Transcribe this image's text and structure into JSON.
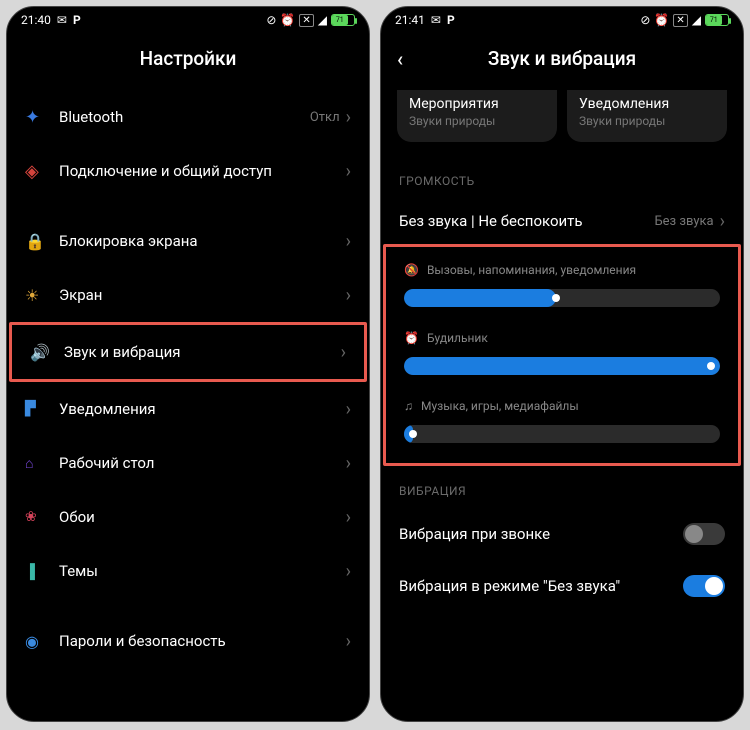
{
  "left": {
    "status": {
      "time": "21:40",
      "battery_pct": "71"
    },
    "title": "Настройки",
    "rows": [
      {
        "label": "Bluetooth",
        "value": "Откл"
      },
      {
        "label": "Подключение и общий доступ"
      },
      {
        "label": "Блокировка экрана"
      },
      {
        "label": "Экран"
      },
      {
        "label": "Звук и вибрация"
      },
      {
        "label": "Уведомления"
      },
      {
        "label": "Рабочий стол"
      },
      {
        "label": "Обои"
      },
      {
        "label": "Темы"
      },
      {
        "label": "Пароли и безопасность"
      }
    ]
  },
  "right": {
    "status": {
      "time": "21:41",
      "battery_pct": "71"
    },
    "title": "Звук и вибрация",
    "cards": [
      {
        "title": "Мероприятия",
        "sub": "Звуки природы"
      },
      {
        "title": "Уведомления",
        "sub": "Звуки природы"
      }
    ],
    "section_volume": "ГРОМКОСТЬ",
    "silent_row": {
      "label": "Без звука | Не беспокоить",
      "value": "Без звука"
    },
    "sliders": [
      {
        "label": "Вызовы, напоминания, уведомления",
        "pct": 48
      },
      {
        "label": "Будильник",
        "pct": 100
      },
      {
        "label": "Музыка, игры, медиафайлы",
        "pct": 3
      }
    ],
    "section_vibration": "ВИБРАЦИЯ",
    "toggles": [
      {
        "label": "Вибрация при звонке",
        "on": false
      },
      {
        "label": "Вибрация в режиме \"Без звука\"",
        "on": true
      }
    ]
  }
}
